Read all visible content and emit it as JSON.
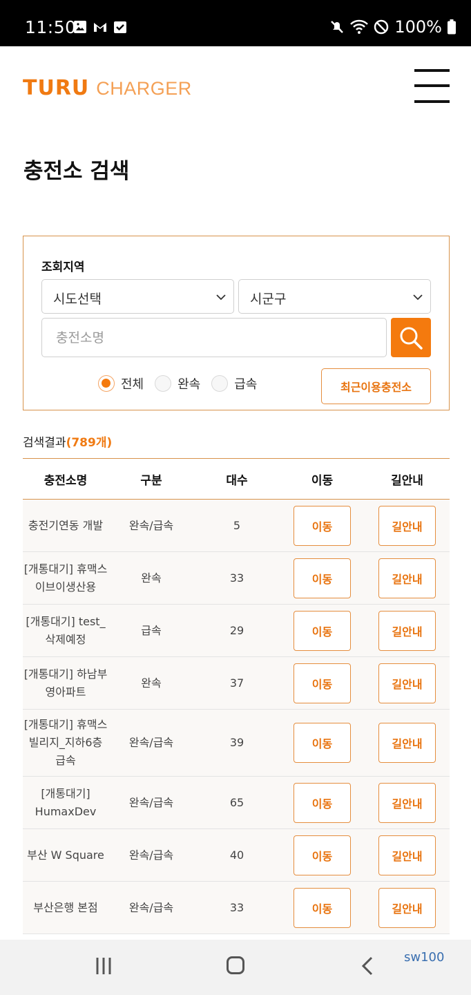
{
  "status_bar": {
    "time": "11:50",
    "battery": "100%",
    "icons": [
      "image-icon",
      "gmail-icon",
      "check-box-icon",
      "mute-icon",
      "wifi-icon",
      "do-not-disturb-icon",
      "battery-icon"
    ]
  },
  "header": {
    "logo_primary": "TURU",
    "logo_secondary": "CHARGER",
    "menu_icon": "hamburger-menu-icon"
  },
  "page_title": "충전소 검색",
  "search": {
    "region_label": "조회지역",
    "province_select": "시도선택",
    "district_select": "시군구",
    "name_placeholder": "충전소명",
    "search_icon": "search-icon",
    "radio_options": [
      {
        "label": "전체",
        "checked": true
      },
      {
        "label": "완속",
        "checked": false
      },
      {
        "label": "급속",
        "checked": false
      }
    ],
    "recent_button": "최근이용충전소"
  },
  "results": {
    "label": "검색결과",
    "count": "(789개)",
    "columns": [
      "충전소명",
      "구분",
      "대수",
      "이동",
      "길안내"
    ],
    "rows": [
      {
        "name": "충전기연동 개발",
        "type": "완속/급속",
        "count": "5",
        "move": "이동",
        "guide": "길안내"
      },
      {
        "name": "[개통대기] 휴맥스\n이브이생산용",
        "type": "완속",
        "count": "33",
        "move": "이동",
        "guide": "길안내"
      },
      {
        "name": "[개통대기] test_\n삭제예정",
        "type": "급속",
        "count": "29",
        "move": "이동",
        "guide": "길안내"
      },
      {
        "name": "[개통대기] 하남부\n영아파트",
        "type": "완속",
        "count": "37",
        "move": "이동",
        "guide": "길안내"
      },
      {
        "name": "[개통대기] 휴맥스\n빌리지_지하6층\n급속",
        "type": "완속/급속",
        "count": "39",
        "move": "이동",
        "guide": "길안내"
      },
      {
        "name": "[개통대기]\nHumaxDev",
        "type": "완속/급속",
        "count": "65",
        "move": "이동",
        "guide": "길안내"
      },
      {
        "name": "부산 W Square",
        "type": "완속/급속",
        "count": "40",
        "move": "이동",
        "guide": "길안내"
      },
      {
        "name": "부산은행 본점",
        "type": "완속/급속",
        "count": "33",
        "move": "이동",
        "guide": "길안내"
      }
    ]
  },
  "nav_bar": {
    "tag": "sw100",
    "icons": [
      "recent-apps-icon",
      "home-icon",
      "back-icon"
    ]
  },
  "colors": {
    "accent": "#f47a0e",
    "border": "#d7924a"
  }
}
